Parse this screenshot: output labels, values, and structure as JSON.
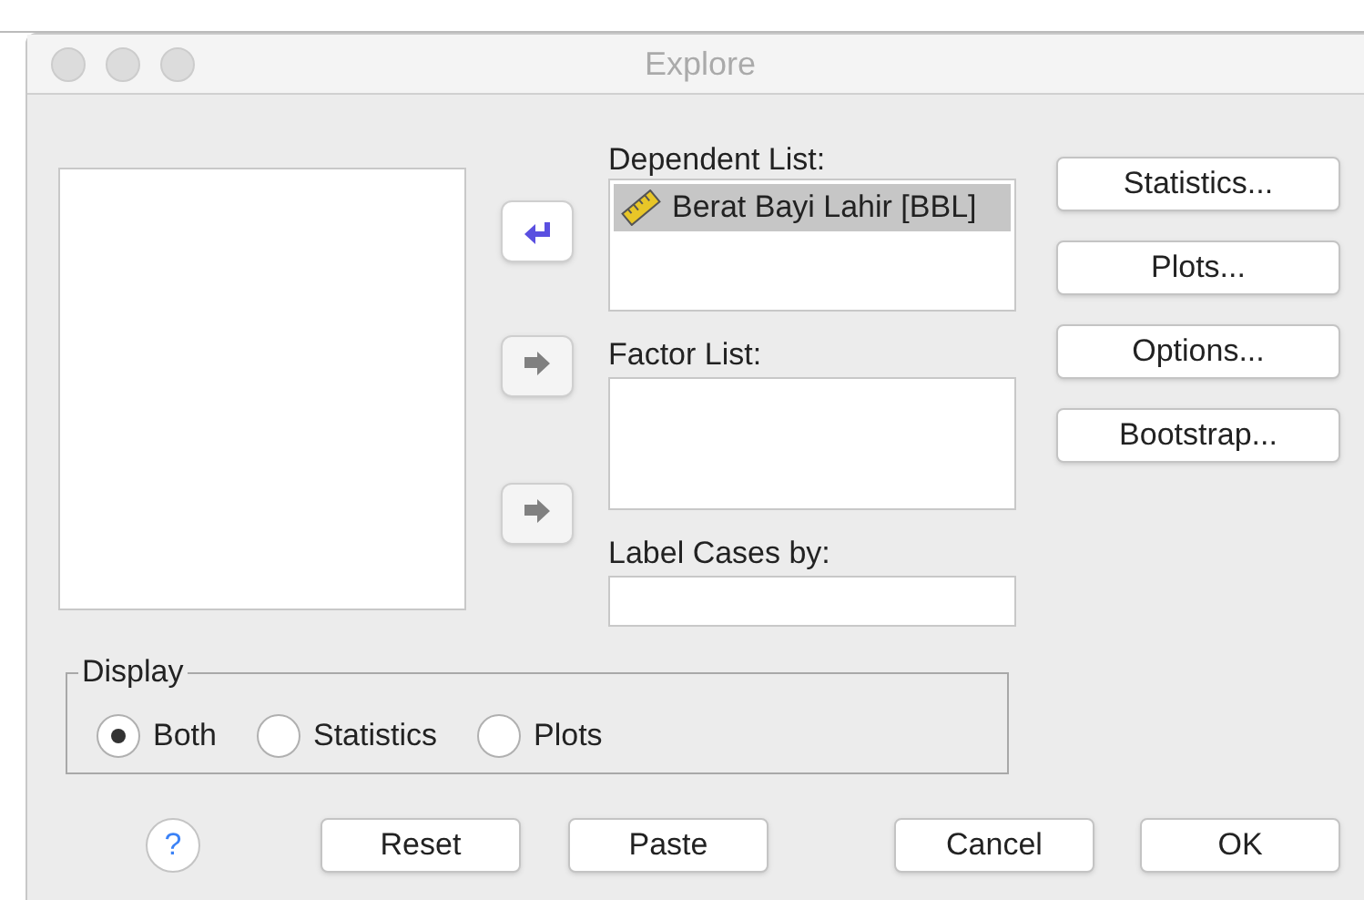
{
  "window": {
    "title": "Explore"
  },
  "transfer_buttons": [
    {
      "kind": "left",
      "disabled": false
    },
    {
      "kind": "right",
      "disabled": true
    },
    {
      "kind": "right",
      "disabled": true
    }
  ],
  "dependent_list": {
    "label": "Dependent List:",
    "items": [
      {
        "label": "Berat Bayi Lahir [BBL]",
        "selected": true
      }
    ]
  },
  "factor_list": {
    "label": "Factor List:"
  },
  "label_cases": {
    "label": "Label Cases by:"
  },
  "side_buttons": [
    "Statistics...",
    "Plots...",
    "Options...",
    "Bootstrap..."
  ],
  "display": {
    "title": "Display",
    "options": [
      {
        "label": "Both",
        "selected": true
      },
      {
        "label": "Statistics",
        "selected": false
      },
      {
        "label": "Plots",
        "selected": false
      }
    ]
  },
  "help": {
    "symbol": "?"
  },
  "bottom_buttons": [
    "Reset",
    "Paste",
    "Cancel",
    "OK"
  ]
}
